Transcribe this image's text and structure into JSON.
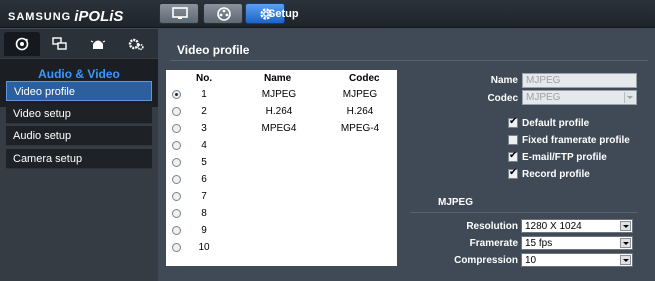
{
  "header": {
    "brand": "SAMSUNG",
    "product": "iPOLiS",
    "nav": [
      {
        "name": "live-view",
        "icon": "monitor-icon"
      },
      {
        "name": "playback",
        "icon": "film-reel-icon"
      },
      {
        "name": "setup",
        "icon": "gear-icon",
        "active": true
      }
    ],
    "section_label": "Setup"
  },
  "sidebar": {
    "tabs": [
      {
        "icon": "camera-lens-icon",
        "active": true
      },
      {
        "icon": "network-icon"
      },
      {
        "icon": "alarm-icon"
      },
      {
        "icon": "gears-icon"
      }
    ],
    "heading": "Audio & Video",
    "items": [
      {
        "label": "Video profile",
        "active": true
      },
      {
        "label": "Video setup"
      },
      {
        "label": "Audio setup"
      },
      {
        "label": "Camera setup"
      }
    ]
  },
  "main": {
    "title": "Video profile",
    "table": {
      "headers": {
        "no": "No.",
        "name": "Name",
        "codec": "Codec"
      },
      "rows": [
        {
          "no": "1",
          "name": "MJPEG",
          "codec": "MJPEG",
          "selected": true
        },
        {
          "no": "2",
          "name": "H.264",
          "codec": "H.264"
        },
        {
          "no": "3",
          "name": "MPEG4",
          "codec": "MPEG-4"
        },
        {
          "no": "4",
          "name": "",
          "codec": ""
        },
        {
          "no": "5",
          "name": "",
          "codec": ""
        },
        {
          "no": "6",
          "name": "",
          "codec": ""
        },
        {
          "no": "7",
          "name": "",
          "codec": ""
        },
        {
          "no": "8",
          "name": "",
          "codec": ""
        },
        {
          "no": "9",
          "name": "",
          "codec": ""
        },
        {
          "no": "10",
          "name": "",
          "codec": ""
        }
      ]
    },
    "form": {
      "name_label": "Name",
      "name_value": "MJPEG",
      "codec_label": "Codec",
      "codec_value": "MJPEG",
      "options": [
        {
          "label": "Default profile",
          "checked": true
        },
        {
          "label": "Fixed framerate profile",
          "checked": false
        },
        {
          "label": "E-mail/FTP profile",
          "checked": true
        },
        {
          "label": "Record profile",
          "checked": true
        }
      ]
    },
    "codec_settings": {
      "title": "MJPEG",
      "resolution_label": "Resolution",
      "resolution_value": "1280 X 1024",
      "framerate_label": "Framerate",
      "framerate_value": "15 fps",
      "compression_label": "Compression",
      "compression_value": "10"
    }
  },
  "colors": {
    "accent": "#3c97ff",
    "active_nav": "#1c63c8",
    "background": "#3f4a56"
  }
}
